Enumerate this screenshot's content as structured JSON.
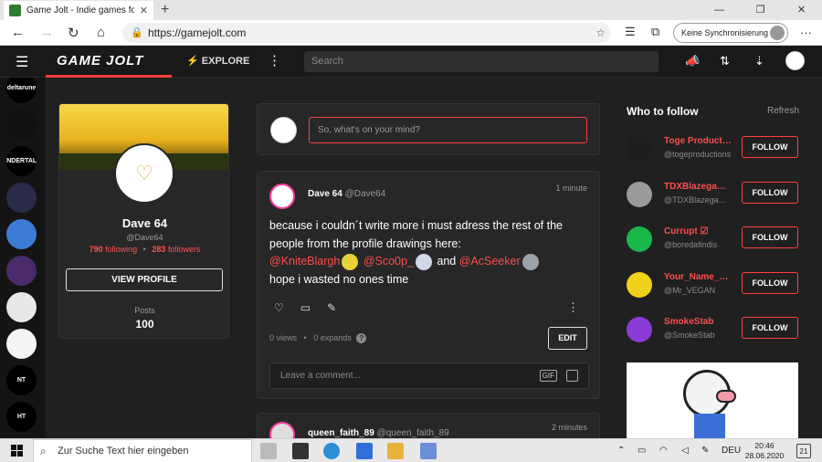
{
  "browser": {
    "tab_title": "Game Jolt - Indie games for the l",
    "url": "https://gamejolt.com",
    "sync_label": "Keine Synchronisierung"
  },
  "site": {
    "logo": "GAME JOLT",
    "explore": "EXPLORE",
    "search_placeholder": "Search"
  },
  "rail": {
    "items": [
      {
        "label": "deltarune",
        "color": "#000000"
      },
      {
        "label": "",
        "color": "#111111"
      },
      {
        "label": "UNDERTALE",
        "color": "#000000"
      },
      {
        "label": "",
        "color": "#2a2a4a"
      },
      {
        "label": "",
        "color": "#3c7bd6"
      },
      {
        "label": "",
        "color": "#4a2a6a"
      },
      {
        "label": "",
        "color": "#e8e8e8"
      },
      {
        "label": "",
        "color": "#f4f4f4"
      },
      {
        "label": "NT",
        "color": "#000000"
      },
      {
        "label": "HT",
        "color": "#000000"
      },
      {
        "label": "",
        "color": "#5a5a8a"
      }
    ]
  },
  "profile": {
    "name": "Dave 64",
    "handle": "@Dave64",
    "following_count": "790",
    "following_label": "following",
    "followers_count": "283",
    "followers_label": "followers",
    "view_button": "VIEW PROFILE",
    "posts_label": "Posts",
    "posts_count": "100"
  },
  "compose": {
    "placeholder": "So, what's on your mind?"
  },
  "post": {
    "author": "Dave 64",
    "handle": "@Dave64",
    "time": "1 minute",
    "text1": "because i couldn´t write more i must adress the rest of the people from the profile drawings here:",
    "mention1": "@KniteBlargh",
    "mention2": "@Sco0p_",
    "and": "and",
    "mention3": "@AcSeeker",
    "text2": "hope i wasted no ones time",
    "views": "0 views",
    "expands": "0 expands",
    "help": "?",
    "edit_button": "EDIT",
    "comment_placeholder": "Leave a comment...",
    "gif_label": "GIF"
  },
  "post2": {
    "author": "queen_faith_89",
    "handle": "@queen_faith_89",
    "time": "2 minutes"
  },
  "who_to_follow": {
    "title": "Who to follow",
    "refresh": "Refresh",
    "users": [
      {
        "name": "Toge Productions",
        "handle": "@togeproductions",
        "avatar_color": "#1d1d1d",
        "follow": "FOLLOW"
      },
      {
        "name": "TDXBlazegames",
        "handle": "@TDXBlazegames",
        "avatar_color": "#9a9a9a",
        "follow": "FOLLOW"
      },
      {
        "name": "Currupt ☑",
        "handle": "@boredafindis",
        "avatar_color": "#18b84a",
        "follow": "FOLLOW"
      },
      {
        "name": "Your_Name_Here",
        "handle": "@Mr_VEGAN",
        "avatar_color": "#f0d11b",
        "follow": "FOLLOW"
      },
      {
        "name": "SmokeStab",
        "handle": "@SmokeStab",
        "avatar_color": "#8a3bd6",
        "follow": "FOLLOW"
      }
    ]
  },
  "taskbar": {
    "search_placeholder": "Zur Suche Text hier eingeben",
    "lang": "DEU",
    "time": "20:46",
    "date": "28.06.2020",
    "notifications": "21"
  }
}
